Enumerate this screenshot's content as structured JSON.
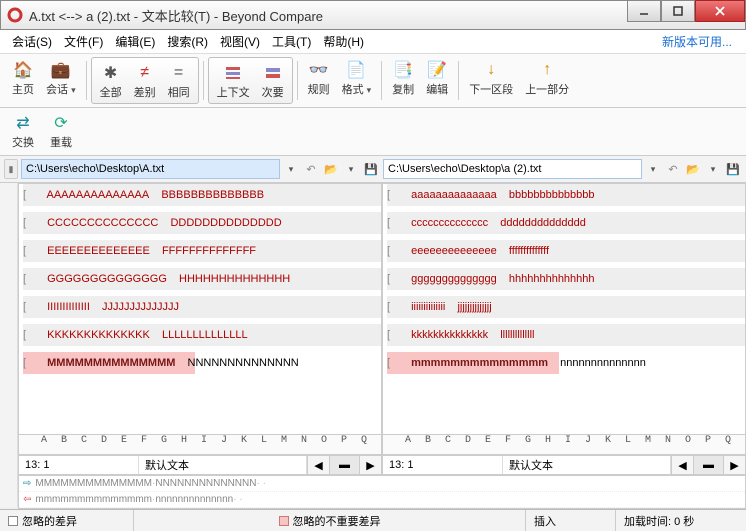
{
  "window": {
    "title": "A.txt <--> a (2).txt - 文本比较(T) - Beyond Compare"
  },
  "menu": [
    "会话(S)",
    "文件(F)",
    "编辑(E)",
    "搜索(R)",
    "视图(V)",
    "工具(T)",
    "帮助(H)"
  ],
  "new_version": "新版本可用...",
  "toolbar": {
    "home": "主页",
    "sessions": "会话",
    "all": "全部",
    "diff": "差别",
    "same": "相同",
    "context": "上下文",
    "minor": "次要",
    "rules": "规则",
    "format": "格式",
    "copy": "复制",
    "edit": "编辑",
    "nextsec": "下一区段",
    "prevsec": "上一部分",
    "swap": "交换",
    "reload": "重载"
  },
  "paths": {
    "left": "C:\\Users\\echo\\Desktop\\A.txt",
    "right": "C:\\Users\\echo\\Desktop\\a (2).txt"
  },
  "left_lines": [
    {
      "a": "AAAAAAAAAAAAAA",
      "b": "BBBBBBBBBBBBBB",
      "t": "diff"
    },
    {
      "a": "CCCCCCCCCCCCCC",
      "b": "DDDDDDDDDDDDDD",
      "t": "diff"
    },
    {
      "a": "EEEEEEEEEEEEEE",
      "b": "FFFFFFFFFFFFFF",
      "t": "diff"
    },
    {
      "a": "GGGGGGGGGGGGGG",
      "b": "HHHHHHHHHHHHHH",
      "t": "diff"
    },
    {
      "a": "IIIIIIIIIIIIII",
      "b": "JJJJJJJJJJJJJJ",
      "t": "diff"
    },
    {
      "a": "KKKKKKKKKKKKKK",
      "b": "LLLLLLLLLLLLLL",
      "t": "diff"
    },
    {
      "a": "MMMMMMMMMMMMMM",
      "b": "NNNNNNNNNNNNNN",
      "t": "diffred"
    }
  ],
  "right_lines": [
    {
      "a": "aaaaaaaaaaaaaa",
      "b": "bbbbbbbbbbbbbb",
      "t": "diff"
    },
    {
      "a": "cccccccccccccc",
      "b": "dddddddddddddd",
      "t": "diff"
    },
    {
      "a": "eeeeeeeeeeeeee",
      "b": "ffffffffffffff",
      "t": "diff"
    },
    {
      "a": "gggggggggggggg",
      "b": "hhhhhhhhhhhhhh",
      "t": "diff"
    },
    {
      "a": "iiiiiiiiiiiiii",
      "b": "jjjjjjjjjjjjjj",
      "t": "diff"
    },
    {
      "a": "kkkkkkkkkkkkkk",
      "b": "llllllllllllll",
      "t": "diff"
    },
    {
      "a": "mmmmmmmmmmmmmm",
      "b": "nnnnnnnnnnnnnn",
      "t": "diffred"
    }
  ],
  "ruler": "A B C D E F G H I J K L M N O P Q R S T U V",
  "ruler_right": "A B C D E F G H I J K L M N O P Q R S",
  "info": {
    "pos": "13: 1",
    "syntax": "默认文本"
  },
  "merge": {
    "l1_a": "MMMMMMMMMMMMMM",
    "l1_b": "NNNNNNNNNNNNNN",
    "l2_a": "mmmmmmmmmmmmmm",
    "l2_b": "nnnnnnnnnnnnnn"
  },
  "status": {
    "ignored": "忽略的差异",
    "ignored_unimp": "忽略的不重要差异",
    "insert": "插入",
    "load": "加载时间: 0 秒"
  }
}
